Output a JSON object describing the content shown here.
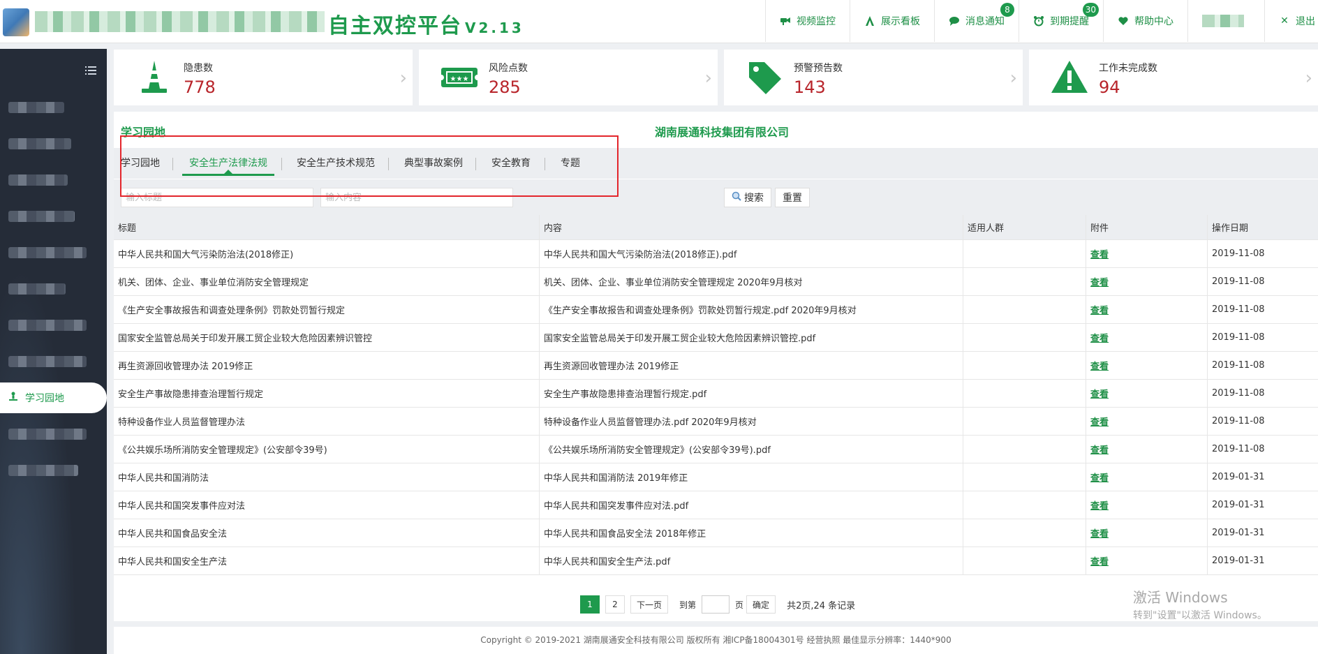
{
  "header": {
    "brand_title": "自主双控平台",
    "brand_version": "V2.13",
    "nav": [
      {
        "label": "视频监控",
        "icon": "camera-icon",
        "badge": ""
      },
      {
        "label": "展示看板",
        "icon": "dashboard-icon",
        "badge": ""
      },
      {
        "label": "消息通知",
        "icon": "message-icon",
        "badge": "8"
      },
      {
        "label": "到期提醒",
        "icon": "alarm-clock-icon",
        "badge": "30"
      },
      {
        "label": "帮助中心",
        "icon": "heart-icon",
        "badge": ""
      }
    ],
    "logout_label": "退出"
  },
  "sidebar": {
    "active_item": "学习园地"
  },
  "stats": [
    {
      "label": "隐患数",
      "value": "778",
      "icon": "traffic-cone-icon"
    },
    {
      "label": "风险点数",
      "value": "285",
      "icon": "ticket-icon"
    },
    {
      "label": "预警预告数",
      "value": "143",
      "icon": "tag-icon"
    },
    {
      "label": "工作未完成数",
      "value": "94",
      "icon": "warning-icon"
    }
  ],
  "panel": {
    "title": "学习园地",
    "company": "湖南展通科技集团有限公司",
    "tabs": [
      "学习园地",
      "安全生产法律法规",
      "安全生产技术规范",
      "典型事故案例",
      "安全教育",
      "专题"
    ],
    "active_tab": 1,
    "filter": {
      "title_placeholder": "输入标题",
      "content_placeholder": "输入内容",
      "search_label": "搜索",
      "reset_label": "重置"
    },
    "columns": [
      "标题",
      "内容",
      "适用人群",
      "附件",
      "操作日期"
    ],
    "rows": [
      {
        "title": "中华人民共和国大气污染防治法(2018修正)",
        "content": "中华人民共和国大气污染防治法(2018修正).pdf",
        "group": "",
        "attach": "查看",
        "date": "2019-11-08"
      },
      {
        "title": "机关、团体、企业、事业单位消防安全管理规定",
        "content": "机关、团体、企业、事业单位消防安全管理规定 2020年9月核对",
        "group": "",
        "attach": "查看",
        "date": "2019-11-08"
      },
      {
        "title": "《生产安全事故报告和调查处理条例》罚款处罚暂行规定",
        "content": "《生产安全事故报告和调查处理条例》罚款处罚暂行规定.pdf 2020年9月核对",
        "group": "",
        "attach": "查看",
        "date": "2019-11-08"
      },
      {
        "title": "国家安全监管总局关于印发开展工贸企业较大危险因素辨识管控",
        "content": "国家安全监管总局关于印发开展工贸企业较大危险因素辨识管控.pdf",
        "group": "",
        "attach": "查看",
        "date": "2019-11-08"
      },
      {
        "title": "再生资源回收管理办法 2019修正",
        "content": "再生资源回收管理办法 2019修正",
        "group": "",
        "attach": "查看",
        "date": "2019-11-08"
      },
      {
        "title": "安全生产事故隐患排查治理暂行规定",
        "content": "安全生产事故隐患排查治理暂行规定.pdf",
        "group": "",
        "attach": "查看",
        "date": "2019-11-08"
      },
      {
        "title": "特种设备作业人员监督管理办法",
        "content": "特种设备作业人员监督管理办法.pdf 2020年9月核对",
        "group": "",
        "attach": "查看",
        "date": "2019-11-08"
      },
      {
        "title": "《公共娱乐场所消防安全管理规定》(公安部令39号)",
        "content": "《公共娱乐场所消防安全管理规定》(公安部令39号).pdf",
        "group": "",
        "attach": "查看",
        "date": "2019-11-08"
      },
      {
        "title": "中华人民共和国消防法",
        "content": "中华人民共和国消防法 2019年修正",
        "group": "",
        "attach": "查看",
        "date": "2019-01-31"
      },
      {
        "title": "中华人民共和国突发事件应对法",
        "content": "中华人民共和国突发事件应对法.pdf",
        "group": "",
        "attach": "查看",
        "date": "2019-01-31"
      },
      {
        "title": "中华人民共和国食品安全法",
        "content": "中华人民共和国食品安全法 2018年修正",
        "group": "",
        "attach": "查看",
        "date": "2019-01-31"
      },
      {
        "title": "中华人民共和国安全生产法",
        "content": "中华人民共和国安全生产法.pdf",
        "group": "",
        "attach": "查看",
        "date": "2019-01-31"
      }
    ],
    "pager": {
      "pages": [
        "1",
        "2"
      ],
      "current": "1",
      "next_label": "下一页",
      "goto_label": "到第",
      "page_unit": "页",
      "confirm_label": "确定",
      "summary": "共2页,24 条记录"
    }
  },
  "watermark": {
    "line1": "激活 Windows",
    "line2": "转到\"设置\"以激活 Windows。"
  },
  "footer": {
    "copyright": "Copyright © 2019-2021 湖南展通安全科技有限公司 版权所有 湘ICP备18004301号 经营执照   最佳显示分辨率：1440*900"
  }
}
